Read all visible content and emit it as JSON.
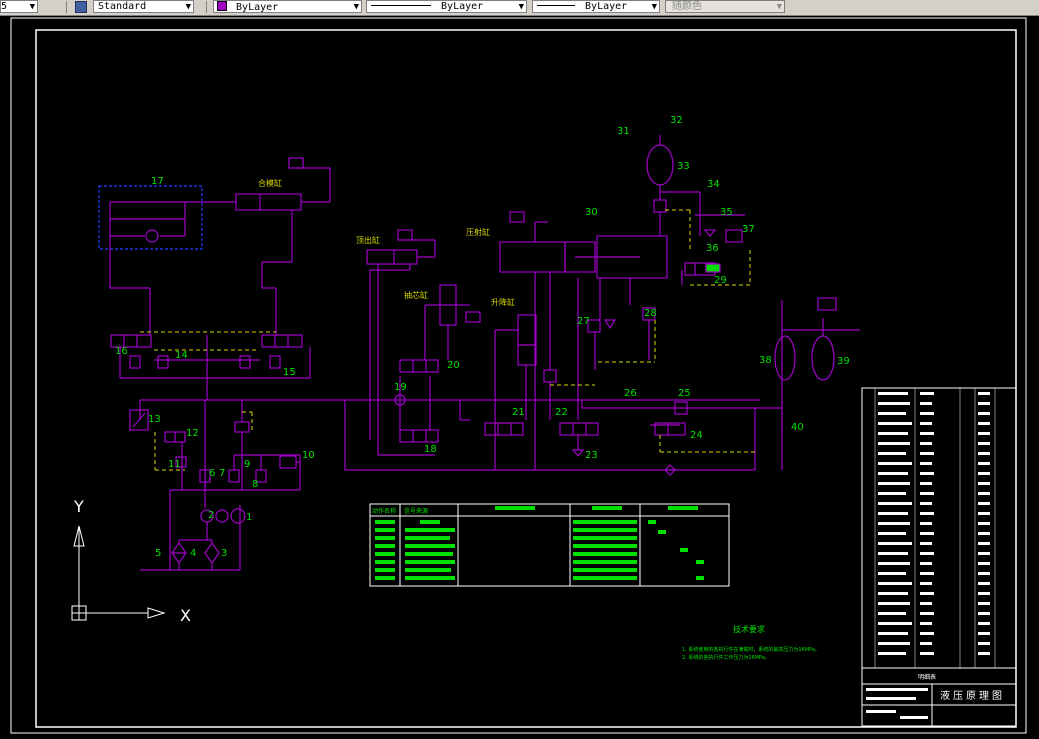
{
  "toolbar": {
    "layer_prefix": "5",
    "text_style": "Standard",
    "layer_value": "ByLayer",
    "linetype_value": "ByLayer",
    "lineweight_value": "ByLayer",
    "plotstyle_value": "随颜色"
  },
  "labels": {
    "cyl_clamp": "合模缸",
    "cyl_eject": "顶出缸",
    "cyl_core": "抽芯缸",
    "cyl_lift": "升降缸",
    "cyl_press": "压射缸",
    "tech_title": "技术要求",
    "tech_1": "1. 系统使用的各执行件在满载时，系统的最高压力为16MPa。",
    "tech_2": "2. 系统的各执行件工作压力为16MPa。",
    "title_name": "液压原理图",
    "title_sub": "明细表",
    "ucs_y": "Y",
    "ucs_x": "X"
  },
  "components": {
    "n1": "1",
    "n2": "2",
    "n3": "3",
    "n4": "4",
    "n5": "5",
    "n6": "6",
    "n7": "7",
    "n8": "8",
    "n9": "9",
    "n10": "10",
    "n11": "11",
    "n12": "12",
    "n13": "13",
    "n14": "14",
    "n15": "15",
    "n16": "16",
    "n17": "17",
    "n18": "18",
    "n19": "19",
    "n20": "20",
    "n21": "21",
    "n22": "22",
    "n23": "23",
    "n24": "24",
    "n25": "25",
    "n26": "26",
    "n27": "27",
    "n28": "28",
    "n29": "29",
    "n30": "30",
    "n31": "31",
    "n32": "32",
    "n33": "33",
    "n34": "34",
    "n35": "35",
    "n36": "36",
    "n37": "37",
    "n38": "38",
    "n39": "39",
    "n40": "40"
  },
  "table": {
    "header_1": "动作名称",
    "header_2": "信号来源"
  },
  "colors": {
    "line": "#a000c8",
    "label": "#d8d800",
    "number": "#00e000",
    "frame": "#ffffff",
    "dashed": "#d8d800",
    "blue_box": "#2040ff"
  }
}
